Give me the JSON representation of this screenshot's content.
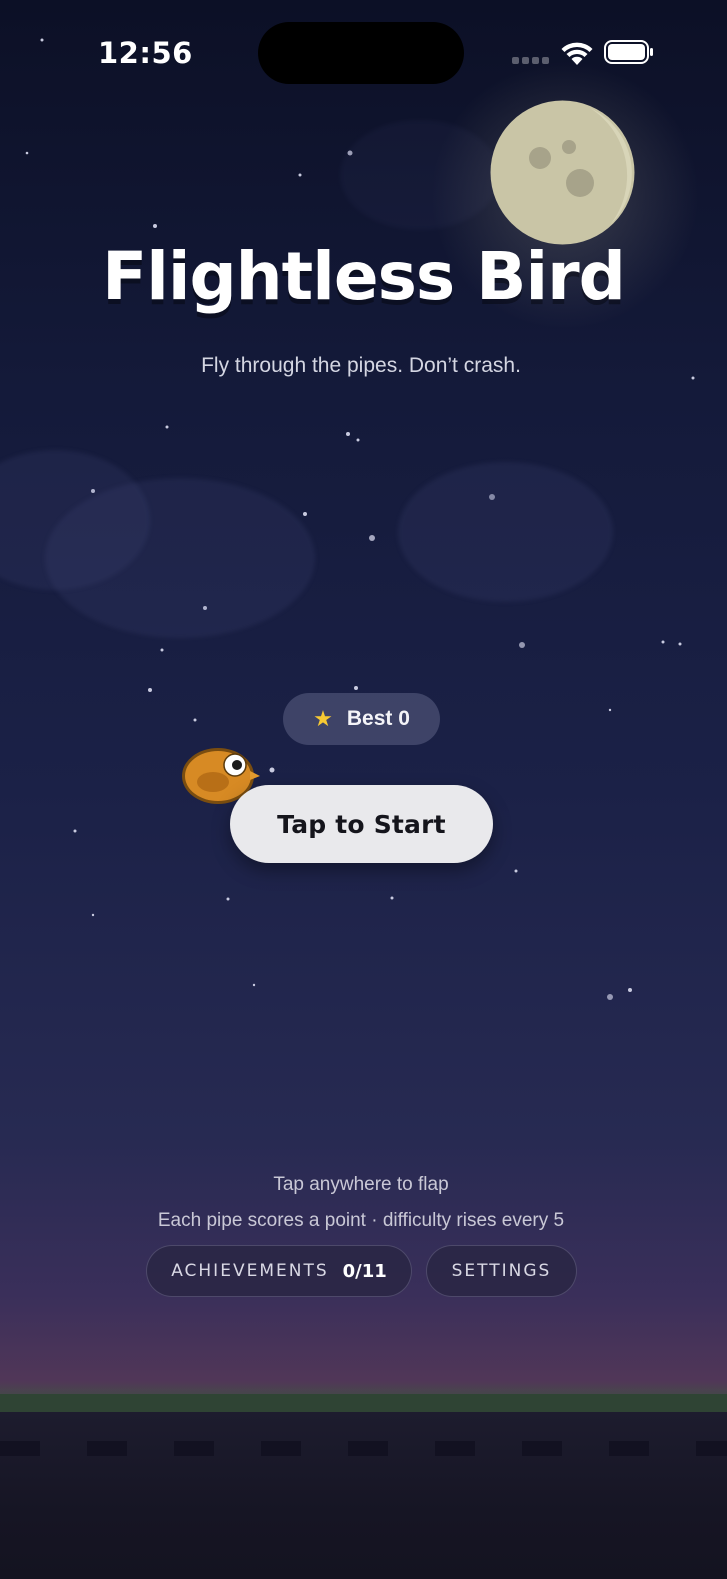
{
  "status_bar": {
    "time": "12:56"
  },
  "title": "Flightless Bird",
  "subtitle": "Fly through the pipes. Don’t crash.",
  "best": {
    "star_icon": "★",
    "label": "Best 0",
    "score": 0
  },
  "start_button": {
    "label": "Tap to Start"
  },
  "hints": {
    "line1": "Tap anywhere to flap",
    "line2": "Each pipe scores a point · difficulty rises every 5"
  },
  "achievements": {
    "label": "ACHIEVEMENTS",
    "count": "0/11"
  },
  "settings": {
    "label": "SETTINGS"
  },
  "icons": {
    "moon": "moon-icon",
    "bird": "bird-icon",
    "wifi": "wifi-icon",
    "battery": "battery-icon"
  },
  "colors": {
    "accent_star": "#f7c933",
    "button_bg": "#e9e9ec",
    "bird_body": "#d78a24"
  }
}
